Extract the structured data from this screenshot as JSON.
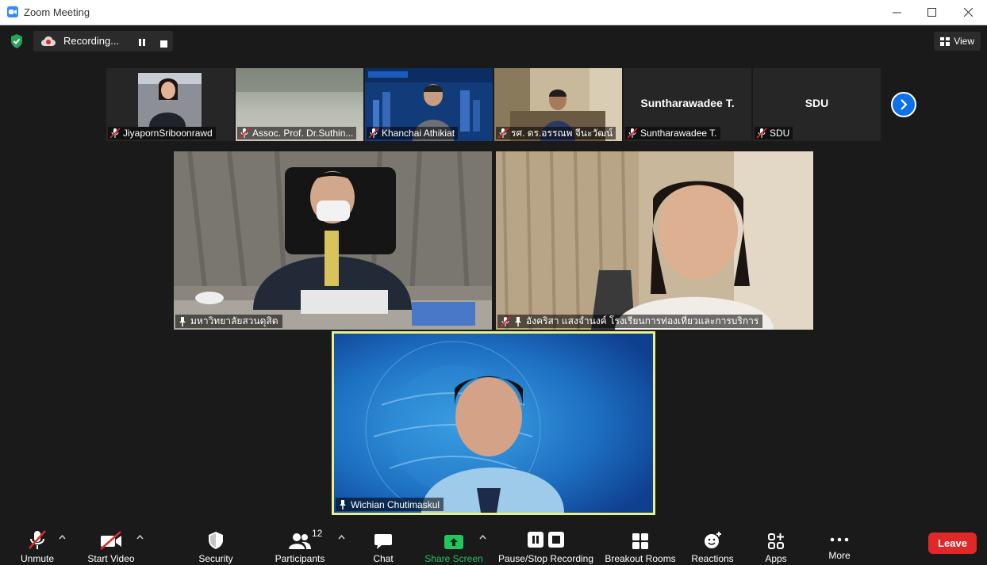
{
  "window": {
    "title": "Zoom Meeting"
  },
  "topbar": {
    "recording_label": "Recording...",
    "view_label": "View"
  },
  "participants_strip": [
    {
      "name": "JiyapornSriboonrawd",
      "muted": true
    },
    {
      "name": "Assoc. Prof. Dr.Suthin...",
      "muted": true
    },
    {
      "name": "Khanchai Athikiat",
      "muted": true
    },
    {
      "name": "รศ. ดร.อรรณพ จีนะวัฒน์",
      "muted": true
    },
    {
      "name": "Suntharawadee T.",
      "display": "Suntharawadee T.",
      "muted": true
    },
    {
      "name": "SDU",
      "display": "SDU",
      "muted": true
    }
  ],
  "main_tiles": {
    "left": {
      "name": "มหาวิทยาลัยสวนดุสิต"
    },
    "right": {
      "name": "อังคริสา แสงจำนงค์ โรงเรียนการท่องเที่ยวและการบริการ"
    },
    "bottom": {
      "name": "Wichian Chutimaskul"
    }
  },
  "toolbar": {
    "unmute": "Unmute",
    "start_video": "Start Video",
    "security": "Security",
    "participants": "Participants",
    "participants_count": "12",
    "chat": "Chat",
    "share_screen": "Share Screen",
    "pause_recording": "Pause/Stop Recording",
    "breakout_rooms": "Breakout Rooms",
    "reactions": "Reactions",
    "apps": "Apps",
    "more": "More",
    "leave": "Leave"
  },
  "colors": {
    "accent": "#0e71eb",
    "share_green": "#22c55e",
    "leave_red": "#e02828",
    "active_speaker": "#e8f08a"
  }
}
